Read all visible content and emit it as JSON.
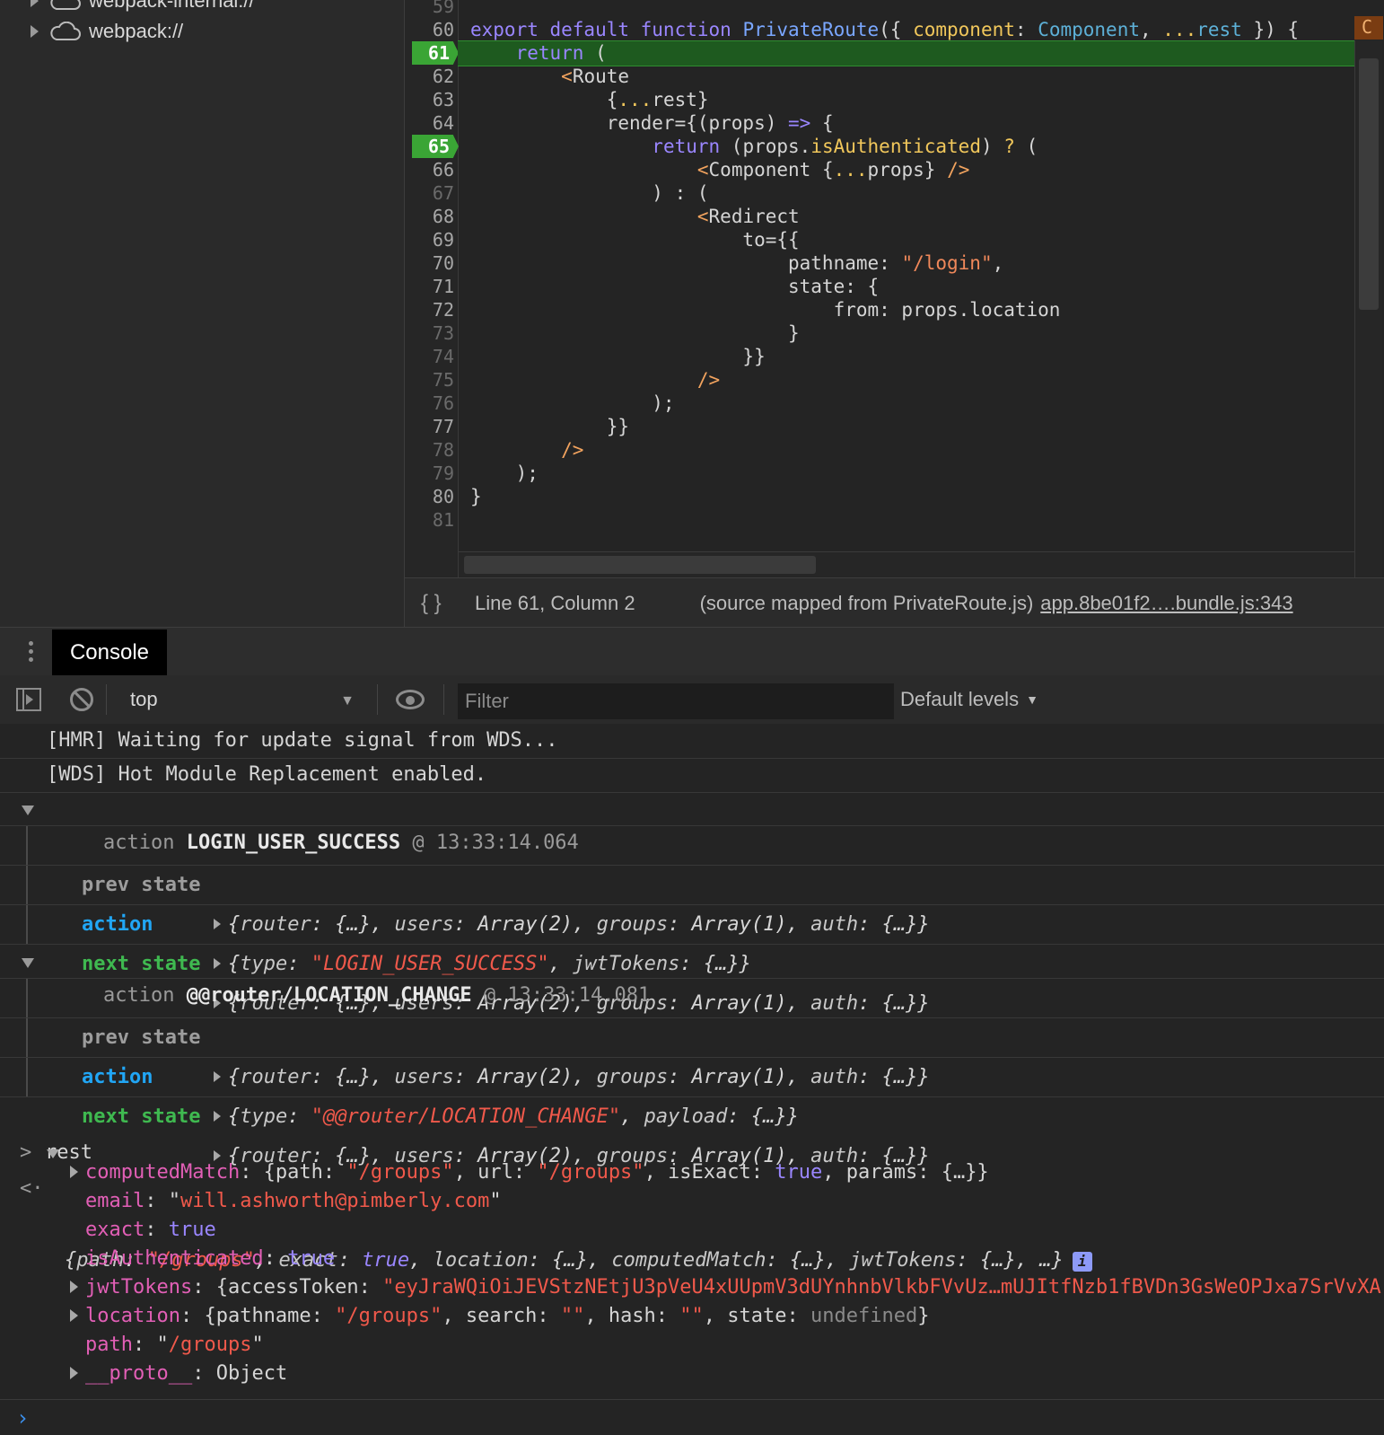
{
  "navigator": {
    "items": [
      {
        "label": "webpack-internal://"
      },
      {
        "label": "webpack://"
      }
    ]
  },
  "editor": {
    "line_numbers": [
      "59",
      "60",
      "61",
      "62",
      "63",
      "64",
      "65",
      "66",
      "67",
      "68",
      "69",
      "70",
      "71",
      "72",
      "73",
      "74",
      "75",
      "76",
      "77",
      "78",
      "79",
      "80",
      "81"
    ],
    "breakpoint_lines": [
      "61",
      "65"
    ],
    "current_line": "61",
    "lines": {
      "l60": {
        "k1": "export default function ",
        "fn": "PrivateRoute",
        "p1": "({ ",
        "pr1": "component",
        "c": ": ",
        "tp": "Component",
        ",": ", ",
        "pr2": "...rest",
        " }": " }) {"
      },
      "l61": "return (",
      "l62": "<Route",
      "l63": "{...rest}",
      "l64": "render={(props) => {",
      "l65": "return (props.isAuthenticated) ? (",
      "l66": "<Component {...props} />",
      "l67": ") : (",
      "l68": "<Redirect",
      "l69": "to={{",
      "l70": "pathname: \"/login\",",
      "l71": "state: {",
      "l72": "from: props.location",
      "l73": "}",
      "l74": "}}",
      "l75": "/>",
      "l76": ");",
      "l77": "}}",
      "l78": "/>",
      "l79": ");",
      "l80": "}"
    },
    "marker_glyph": "C"
  },
  "status_bar": {
    "pretty_print_icon": "{ }",
    "position": "Line 61, Column 2",
    "source_mapped": "(source mapped from PrivateRoute.js)",
    "bundle_link": "app.8be01f2….bundle.js:343"
  },
  "drawer": {
    "tab_label": "Console"
  },
  "toolbar": {
    "context": "top",
    "filter_placeholder": "Filter",
    "levels": "Default levels"
  },
  "console": {
    "hmr": "[HMR] Waiting for update signal from WDS...",
    "wds": "[WDS] Hot Module Replacement enabled.",
    "group1": {
      "prefix": "action ",
      "name": "LOGIN_USER_SUCCESS",
      "time": " @ 13:33:14.064",
      "prev_label": "prev state",
      "action_label": "action",
      "next_label": "next state",
      "action_type": "\"LOGIN_USER_SUCCESS\"",
      "action_extra": "jwtTokens"
    },
    "group2": {
      "prefix": "action ",
      "name": "@@router/LOCATION_CHANGE",
      "time": " @ 13:33:14.081",
      "prev_label": "prev state",
      "action_label": "action",
      "next_label": "next state",
      "action_type": "\"@@router/LOCATION_CHANGE\"",
      "action_extra": "payload"
    },
    "state_summary": {
      "router": "router",
      "users": "users",
      "users_val": "Array(2)",
      "groups": "groups",
      "groups_val": "Array(1)",
      "auth": "auth",
      "obj": "{…}"
    },
    "input": "rest",
    "result": {
      "path_val": "\"/groups\"",
      "exact_val": "true",
      "props": {
        "computedMatch_key": "computedMatch",
        "computedMatch_path": "\"/groups\"",
        "computedMatch_url": "\"/groups\"",
        "computedMatch_isExact": "true",
        "email_key": "email",
        "email_val": "will.ashworth@pimberly.com",
        "exact_key": "exact",
        "exact_val": "true",
        "isAuth_key": "isAuthenticated",
        "isAuth_val": "true",
        "jwt_key": "jwtTokens",
        "jwt_val": "\"eyJraWQiOiJEVStzNEtjU3pVeU4xUUpmV3dUYnhnbVlkbFVvUz…mUJItfNzb1fBVDn3GsWeOPJxa7SrVvXA",
        "location_key": "location",
        "loc_pathname": "\"/groups\"",
        "loc_search": "\"\"",
        "loc_hash": "\"\"",
        "loc_state": "undefined",
        "path_key": "path",
        "path_val": "/groups",
        "proto_key": "__proto__",
        "proto_val": "Object"
      }
    },
    "prompt_glyph": "›"
  }
}
